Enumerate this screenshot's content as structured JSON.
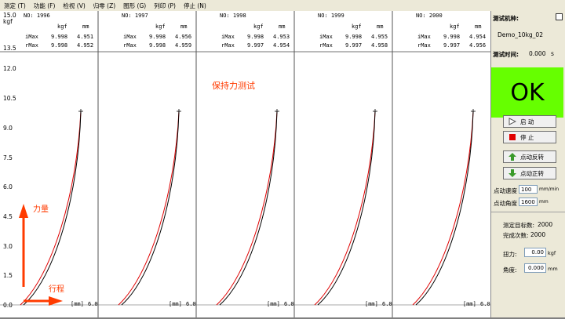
{
  "menu": [
    {
      "name": "menu-measure",
      "label": "测定 (T)"
    },
    {
      "name": "menu-function",
      "label": "功能 (F)"
    },
    {
      "name": "menu-view",
      "label": "检视 (V)"
    },
    {
      "name": "menu-zero",
      "label": "归零 (Z)"
    },
    {
      "name": "menu-graph",
      "label": "图形 (G)"
    },
    {
      "name": "menu-print",
      "label": "列印 (P)"
    },
    {
      "name": "menu-stop",
      "label": "停止 (N)"
    }
  ],
  "axis": {
    "top_value": "15.0",
    "top_unit": "kgf",
    "ticks": [
      "13.5",
      "12.0",
      "10.5",
      "9.0",
      "7.5",
      "6.0",
      "4.5",
      "3.0",
      "1.5",
      "0.0"
    ],
    "x_unit": "[mm]",
    "x_max": "6.0"
  },
  "panels": [
    {
      "no": "NO: 1996",
      "kgf_header": "kgf",
      "mm_header": "mm",
      "imax_label": "iMax",
      "imax_kgf": "9.998",
      "imax_mm": "4.951",
      "rmax_label": "rMax",
      "rmax_kgf": "9.998",
      "rmax_mm": "4.952"
    },
    {
      "no": "NO: 1997",
      "kgf_header": "kgf",
      "mm_header": "mm",
      "imax_label": "iMax",
      "imax_kgf": "9.998",
      "imax_mm": "4.956",
      "rmax_label": "rMax",
      "rmax_kgf": "9.998",
      "rmax_mm": "4.959"
    },
    {
      "no": "NO: 1998",
      "kgf_header": "kgf",
      "mm_header": "mm",
      "imax_label": "iMax",
      "imax_kgf": "9.998",
      "imax_mm": "4.953",
      "rmax_label": "rMax",
      "rmax_kgf": "9.997",
      "rmax_mm": "4.954"
    },
    {
      "no": "NO: 1999",
      "kgf_header": "kgf",
      "mm_header": "mm",
      "imax_label": "iMax",
      "imax_kgf": "9.998",
      "imax_mm": "4.955",
      "rmax_label": "rMax",
      "rmax_kgf": "9.997",
      "rmax_mm": "4.958"
    },
    {
      "no": "NO: 2000",
      "kgf_header": "kgf",
      "mm_header": "mm",
      "imax_label": "iMax",
      "imax_kgf": "9.998",
      "imax_mm": "4.954",
      "rmax_label": "rMax",
      "rmax_kgf": "9.997",
      "rmax_mm": "4.956"
    }
  ],
  "overlay": {
    "title": "保持力测试",
    "force_label": "力量",
    "travel_label": "行程",
    "accent": "#ff3b00"
  },
  "right_panel": {
    "model_label": "测试机种:",
    "model_value": "Demo_10kg_02",
    "time_label": "测试时间:",
    "time_value": "0.000",
    "time_unit": "s",
    "result": "OK",
    "result_color": "#66ff00",
    "start_label": "启 动",
    "stop_label": "停 止",
    "reverse_label": "点动反转",
    "forward_label": "点动正转",
    "jog_speed_label": "点动速度",
    "jog_speed_value": "100",
    "jog_speed_unit": "mm/min",
    "jog_angle_label": "点动角度",
    "jog_angle_value": "1600",
    "jog_angle_unit": "mm",
    "target_label": "测定目标数:",
    "target_value": "2000",
    "completed_label": "完成次数:",
    "completed_value": "2000",
    "torque_label": "扭力:",
    "torque_value": "0.00",
    "torque_unit": "kgf",
    "angle_label": "角度:",
    "angle_value": "0.000",
    "angle_unit": "mm"
  }
}
